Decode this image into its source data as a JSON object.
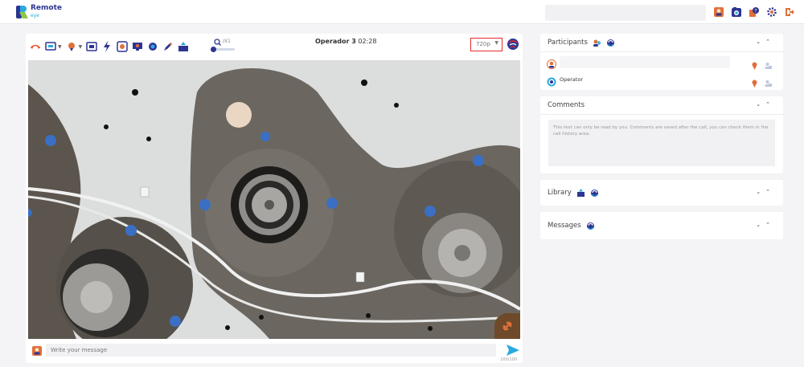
{
  "app": {
    "name": "Remote",
    "tagline": "eye"
  },
  "colors": {
    "brand": "#2d3592",
    "accent": "#2aa9e0",
    "highlight": "#e32b2b"
  },
  "top_icons": [
    "contact-icon",
    "camera-icon",
    "help-icon",
    "settings-gear-icon",
    "logout-icon"
  ],
  "toolbar": {
    "icons": [
      "hangup-icon",
      "screen-share-icon",
      "pointer-icon",
      "capture-icon",
      "flash-icon",
      "record-icon",
      "screen-icon",
      "blur-icon",
      "pen-icon",
      "upload-icon"
    ],
    "zoom_label": "/X1",
    "zoom_level": 0.05
  },
  "call": {
    "operator_name": "Operador 3",
    "duration": "02:28",
    "resolution": "720p"
  },
  "message_bar": {
    "placeholder": "Write your message",
    "counter": "100/100"
  },
  "panels": {
    "participants": {
      "title": "Participants",
      "rows": [
        {
          "name": ""
        },
        {
          "name": "Operator"
        }
      ]
    },
    "comments": {
      "title": "Comments",
      "placeholder": "This text can only be read by you. Comments are saved after the call, you can check them in the call history area."
    },
    "library": {
      "title": "Library"
    },
    "messages": {
      "title": "Messages"
    }
  }
}
